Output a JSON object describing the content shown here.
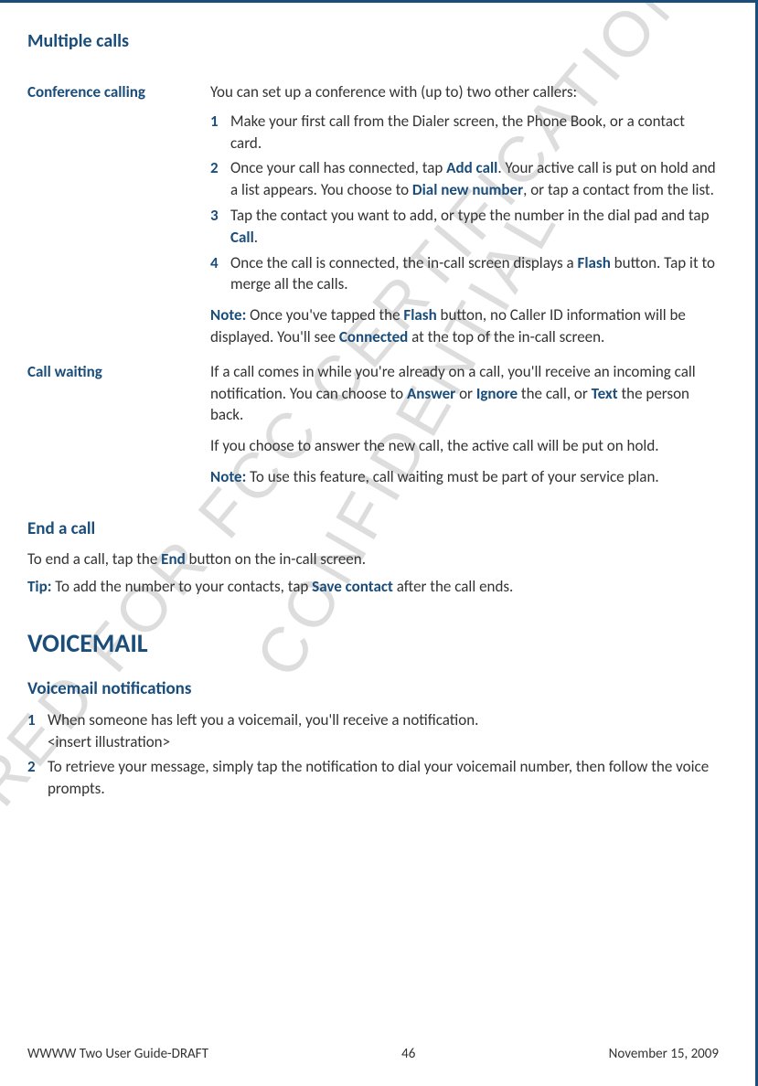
{
  "watermarks": {
    "wm1": "PREPARED FOR FCC CERTIFICATION",
    "wm2": "CONFIDENTIAL"
  },
  "multipleCalls": {
    "heading": "Multiple calls",
    "conference": {
      "label": "Conference calling",
      "intro": "You can set up a conference with (up to) two other callers:",
      "steps": {
        "s1": {
          "num": "1",
          "text": "Make your first call from the Dialer screen, the Phone Book, or a contact card."
        },
        "s2": {
          "num": "2",
          "pre": "Once your call has connected, tap ",
          "b1": "Add call",
          "mid": ". Your active call is put on hold and a list appears. You choose to ",
          "b2": "Dial new number",
          "post": ", or tap a contact from the list."
        },
        "s3": {
          "num": "3",
          "pre": "Tap the contact you want to add, or type the number in the dial pad and tap ",
          "b1": "Call",
          "post": "."
        },
        "s4": {
          "num": "4",
          "pre": "Once the call is connected, the in-call screen displays a ",
          "b1": "Flash",
          "post": " button. Tap it to merge all the calls."
        }
      },
      "note": {
        "label": "Note:",
        "pre": " Once you've tapped the ",
        "b1": "Flash",
        "mid": " button, no Caller ID information will be displayed. You'll see ",
        "b2": "Connected",
        "post": " at the top of the in-call screen."
      }
    },
    "callWaiting": {
      "label": "Call waiting",
      "p1": {
        "pre": "If a call comes in while you're already on a call, you'll receive an incoming call notification. You can choose to ",
        "b1": "Answer",
        "mid1": " or ",
        "b2": "Ignore",
        "mid2": " the call, or ",
        "b3": "Text",
        "post": " the person back."
      },
      "p2": "If you choose to answer the new call, the active call will be put on hold.",
      "note": {
        "label": "Note:",
        "text": " To use this feature, call waiting must be part of your service plan."
      }
    }
  },
  "endCall": {
    "heading": "End a call",
    "line1": {
      "pre": "To end a call, tap the ",
      "b1": "End",
      "post": " button on the in-call screen."
    },
    "tip": {
      "label": "Tip:",
      "pre": " To add the number to your contacts, tap ",
      "b1": "Save contact",
      "post": " after the call ends."
    }
  },
  "voicemail": {
    "heading": "VOICEMAIL",
    "subheading": "Voicemail notifications",
    "steps": {
      "s1": {
        "num": "1",
        "line1": "When someone has left you a voicemail, you'll receive a notification.",
        "line2": "<insert illustration>"
      },
      "s2": {
        "num": "2",
        "text": "To retrieve your message, simply tap the notification to dial your voicemail number, then follow the voice prompts."
      }
    }
  },
  "footer": {
    "left": "WWWW Two User Guide-DRAFT",
    "center": "46",
    "right": "November 15, 2009"
  }
}
